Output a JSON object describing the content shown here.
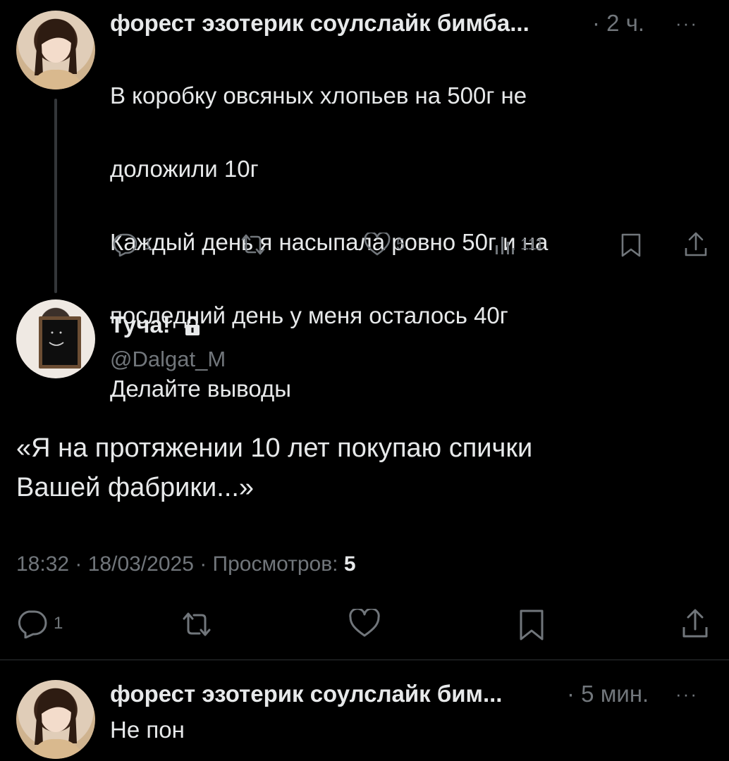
{
  "post1": {
    "author": "форест эзотерик соулслайк бимба...",
    "separator": "·",
    "time": "2 ч.",
    "more": "···",
    "lines": [
      "В коробку овсяных хлопьев на 500г не",
      "доложили 10г",
      "Каждый день я насыпала ровно 50г и на",
      "последний день у меня осталось 40г",
      "Делайте выводы"
    ],
    "actions": {
      "replies": "1",
      "reposts": "",
      "likes": "5",
      "views": "111"
    }
  },
  "post2": {
    "display_name": "Туча!",
    "handle": "@Dalgat_M",
    "text_line1": "«Я на протяжении 10 лет покупаю спички",
    "text_line2": "Вашей фабрики...»",
    "meta": "18:32 · 18/03/2025 · Просмотров: ",
    "views": "5",
    "actions": {
      "replies": "1"
    }
  },
  "post3": {
    "author": "форест эзотерик соулслайк бим...",
    "separator": "·",
    "time": "5 мин.",
    "more": "···",
    "text": "Не пон"
  },
  "colors": {
    "background": "#000000",
    "text": "#e7e9ea",
    "muted": "#71767b",
    "divider": "#2f3336"
  }
}
